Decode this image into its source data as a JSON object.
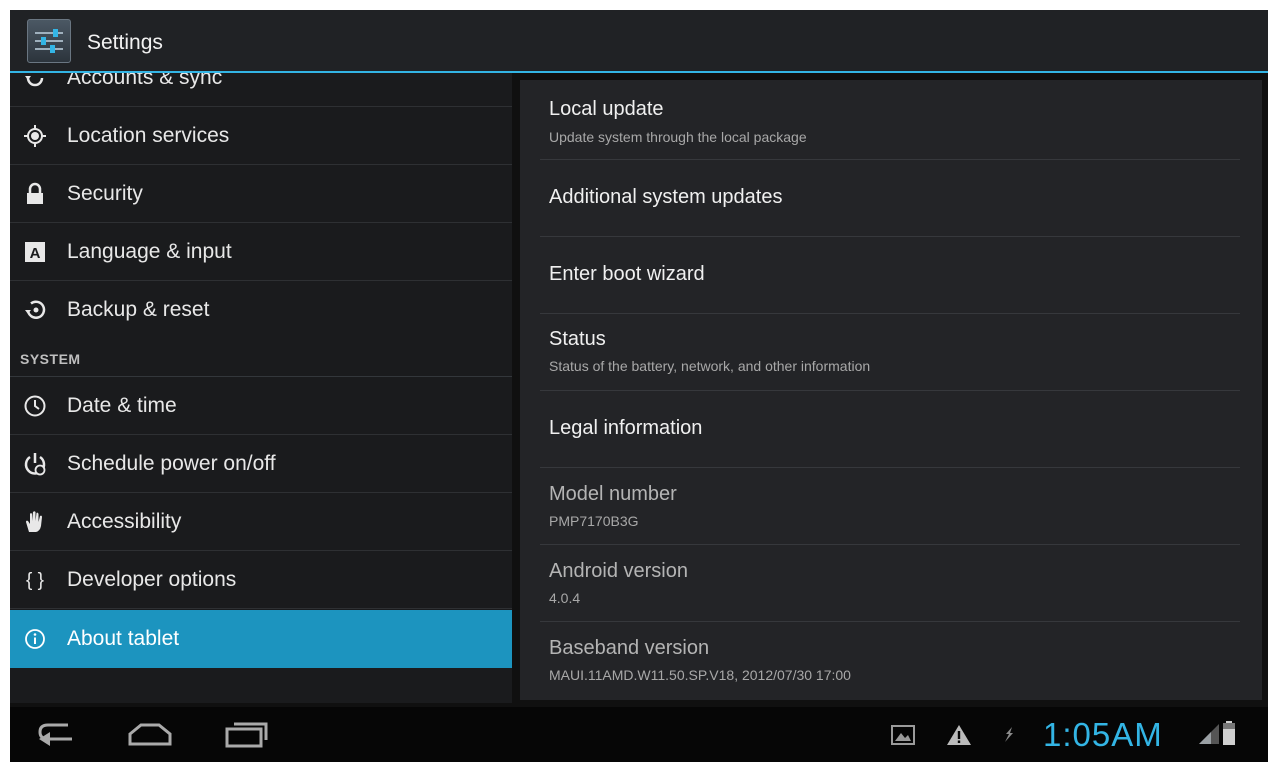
{
  "app": {
    "title": "Settings",
    "icon": "settings-sliders-icon",
    "accent_color": "#33b5e5",
    "selected_color": "#1c94bf"
  },
  "sidebar": {
    "items": [
      {
        "label": "Accounts & sync",
        "icon": "sync-icon"
      },
      {
        "label": "Location services",
        "icon": "location-icon"
      },
      {
        "label": "Security",
        "icon": "lock-icon"
      },
      {
        "label": "Language & input",
        "icon": "language-icon"
      },
      {
        "label": "Backup & reset",
        "icon": "backup-icon"
      }
    ],
    "system_header": "SYSTEM",
    "system_items": [
      {
        "label": "Date & time",
        "icon": "clock-icon"
      },
      {
        "label": "Schedule power on/off",
        "icon": "schedule-power-icon"
      },
      {
        "label": "Accessibility",
        "icon": "hand-icon"
      },
      {
        "label": "Developer options",
        "icon": "braces-icon"
      },
      {
        "label": "About tablet",
        "icon": "info-icon",
        "selected": true
      }
    ]
  },
  "about": {
    "items": [
      {
        "title": "Local update",
        "subtitle": "Update system through the local package"
      },
      {
        "title": "Additional system updates"
      },
      {
        "title": "Enter boot wizard"
      },
      {
        "title": "Status",
        "subtitle": "Status of the battery, network, and other information"
      },
      {
        "title": "Legal information"
      },
      {
        "title": "Model number",
        "subtitle": "PMP7170B3G"
      },
      {
        "title": "Android version",
        "subtitle": "4.0.4"
      },
      {
        "title": "Baseband version",
        "subtitle": "MAUI.11AMD.W11.50.SP.V18, 2012/07/30 17:00"
      }
    ]
  },
  "statusbar": {
    "time": "1:05AM",
    "icons": [
      "gallery-icon",
      "warning-icon",
      "usb-debug-icon",
      "signal-icon",
      "battery-icon"
    ]
  },
  "navbar": {
    "buttons": [
      "back-icon",
      "home-icon",
      "recent-apps-icon"
    ]
  }
}
